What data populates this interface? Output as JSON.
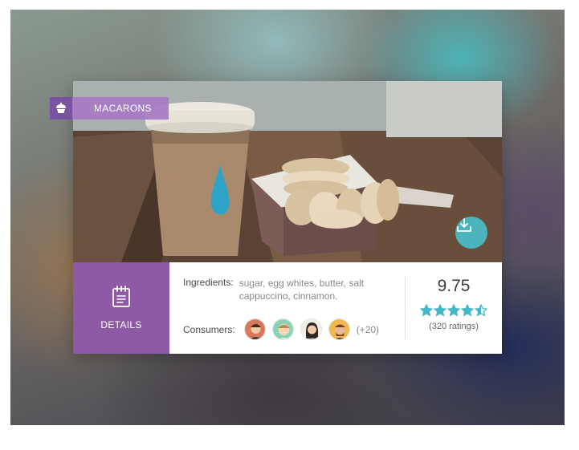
{
  "card": {
    "category": "MACARONS",
    "details_label": "DETAILS",
    "ingredients_label": "Ingredients:",
    "ingredients_text": "sugar, egg whites, butter, salt cappuccino, cinnamon.",
    "consumers_label": "Consumers:",
    "consumers_more": "(+20)",
    "score": "9.75",
    "rating_stars": 4.5,
    "rating_max": 5,
    "ratings_count": "(320 ratings)"
  },
  "icons": {
    "category": "cupcake-icon",
    "details": "notepad-icon",
    "download": "download-icon",
    "star": "star-icon"
  },
  "colors": {
    "purple_dark": "#8e5aa8",
    "purple_light": "#a778c4",
    "teal": "#4ab9c4",
    "star": "#43b8c9"
  }
}
